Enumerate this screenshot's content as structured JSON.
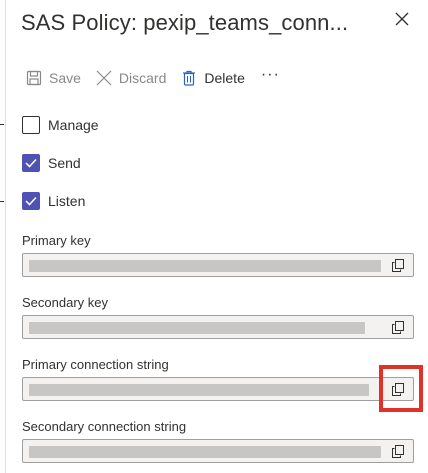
{
  "panel": {
    "title": "SAS Policy: pexip_teams_conn..."
  },
  "toolbar": {
    "save_label": "Save",
    "discard_label": "Discard",
    "delete_label": "Delete",
    "more_label": "···"
  },
  "claims": [
    {
      "label": "Manage",
      "checked": false
    },
    {
      "label": "Send",
      "checked": true
    },
    {
      "label": "Listen",
      "checked": true
    }
  ],
  "fields": [
    {
      "label": "Primary key",
      "value_masked": true
    },
    {
      "label": "Secondary key",
      "value_masked": true
    },
    {
      "label": "Primary connection string",
      "value_masked": true
    },
    {
      "label": "Secondary connection string",
      "value_masked": true
    }
  ],
  "colors": {
    "checkbox_accent": "#4f52b2",
    "highlight": "#e0322b",
    "text": "#323130",
    "disabled_text": "#8a8886",
    "field_bg": "#f3f2f1"
  },
  "icons": {
    "save": "save-icon",
    "discard": "close-icon",
    "delete": "trash-icon",
    "copy": "copy-icon",
    "close": "close-icon",
    "check": "checkmark-icon"
  }
}
